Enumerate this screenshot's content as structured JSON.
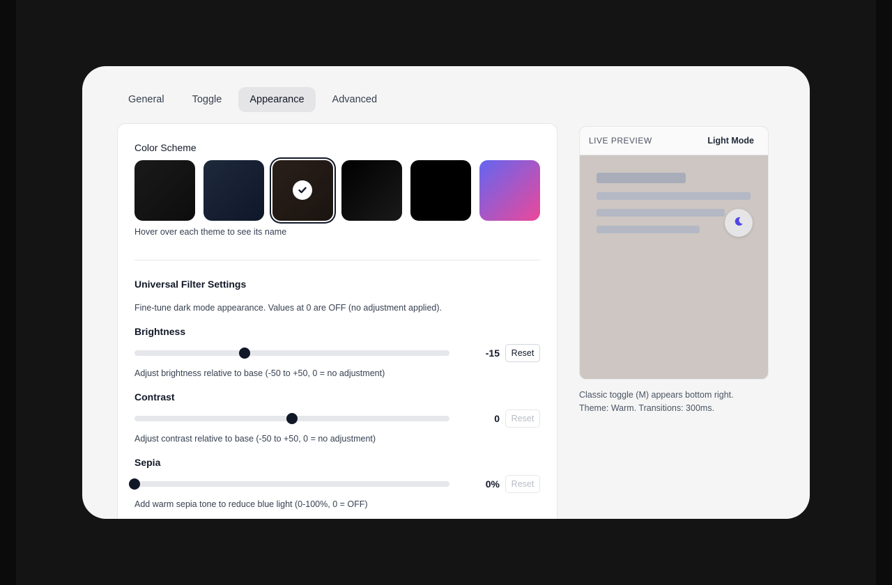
{
  "tabs": [
    {
      "label": "General",
      "active": false
    },
    {
      "label": "Toggle",
      "active": false
    },
    {
      "label": "Appearance",
      "active": true
    },
    {
      "label": "Advanced",
      "active": false
    }
  ],
  "color_scheme": {
    "title": "Color Scheme",
    "hint": "Hover over each theme to see its name",
    "swatches": [
      {
        "colors": [
          "#1a1a1a",
          "#0d0d0d"
        ],
        "selected": false
      },
      {
        "colors": [
          "#1e293b",
          "#0f172a"
        ],
        "selected": false
      },
      {
        "colors": [
          "#2a1f1a",
          "#1a1410"
        ],
        "selected": true
      },
      {
        "colors": [
          "#000000",
          "#1a1a1a"
        ],
        "selected": false
      },
      {
        "colors": [
          "#000000",
          "#000000"
        ],
        "selected": false
      },
      {
        "colors": [
          "#6366f1",
          "#ec4899"
        ],
        "selected": false
      }
    ]
  },
  "filters": {
    "title": "Universal Filter Settings",
    "description": "Fine-tune dark mode appearance. Values at 0 are OFF (no adjustment applied).",
    "items": [
      {
        "label": "Brightness",
        "value": -15,
        "display": "-15",
        "min": -50,
        "max": 50,
        "help": "Adjust brightness relative to base (-50 to +50, 0 = no adjustment)",
        "reset": "Reset",
        "reset_enabled": true
      },
      {
        "label": "Contrast",
        "value": 0,
        "display": "0",
        "min": -50,
        "max": 50,
        "help": "Adjust contrast relative to base (-50 to +50, 0 = no adjustment)",
        "reset": "Reset",
        "reset_enabled": false
      },
      {
        "label": "Sepia",
        "value": 0,
        "display": "0%",
        "min": 0,
        "max": 100,
        "help": "Add warm sepia tone to reduce blue light (0-100%, 0 = OFF)",
        "reset": "Reset",
        "reset_enabled": false
      }
    ]
  },
  "preview": {
    "title": "LIVE PREVIEW",
    "mode": "Light Mode",
    "caption_line1": "Classic toggle (M) appears bottom right.",
    "caption_line2": "Theme: Warm. Transitions: 300ms.",
    "toggle_icon": "moon-icon",
    "accent": "#4f46e5"
  }
}
